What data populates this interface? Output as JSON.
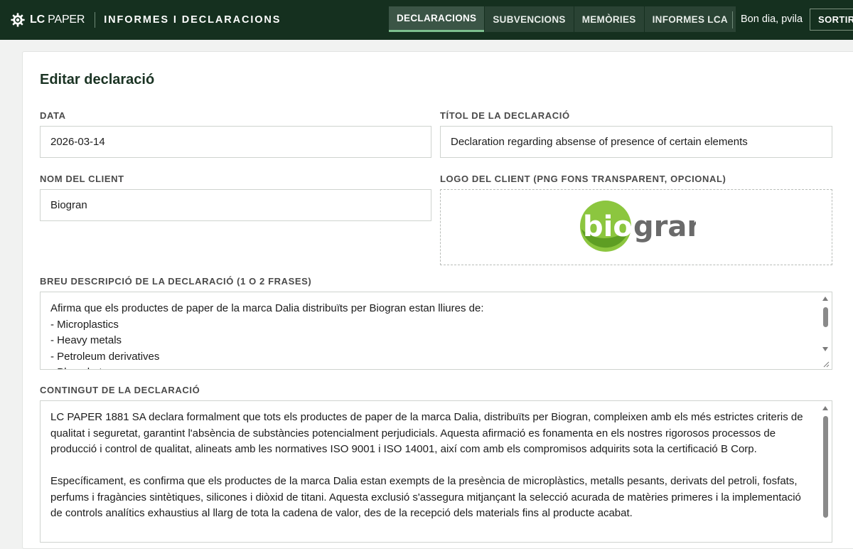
{
  "header": {
    "brand": {
      "bold": "LC",
      "rest": " PAPER"
    },
    "section": "INFORMES I DECLARACIONS",
    "nav": [
      {
        "label": "DECLARACIONS",
        "active": true
      },
      {
        "label": "SUBVENCIONS",
        "active": false
      },
      {
        "label": "MEMÒRIES",
        "active": false
      },
      {
        "label": "INFORMES LCA",
        "active": false
      }
    ],
    "greeting": "Bon dia, pvila",
    "logout_label": "SORTIR"
  },
  "form": {
    "title": "Editar declaració",
    "date": {
      "label": "DATA",
      "value": "2026-03-14"
    },
    "declaration_title": {
      "label": "TÍTOL DE LA DECLARACIÓ",
      "value": "Declaration regarding absense of presence of certain elements"
    },
    "client_name": {
      "label": "NOM DEL CLIENT",
      "value": "Biogran"
    },
    "client_logo": {
      "label": "LOGO DEL CLIENT (PNG FONS TRANSPARENT, OPCIONAL)",
      "logo_text_a": "bio",
      "logo_text_b": "gran"
    },
    "short_description": {
      "label": "BREU DESCRIPCIÓ DE LA DECLARACIÓ (1 O 2 FRASES)",
      "value": "Afirma que els productes de paper de la marca Dalia distribuïts per Biogran estan lliures de:\n- Microplastics\n- Heavy metals\n- Petroleum derivatives\n- Phosphates"
    },
    "content": {
      "label": "CONTINGUT DE LA DECLARACIÓ",
      "value": "LC PAPER 1881 SA declara formalment que tots els productes de paper de la marca Dalia, distribuïts per Biogran, compleixen amb els més estrictes criteris de qualitat i seguretat, garantint l'absència de substàncies potencialment perjudicials. Aquesta afirmació es fonamenta en els nostres rigorosos processos de producció i control de qualitat, alineats amb les normatives ISO 9001 i ISO 14001, així com amb els compromisos adquirits sota la certificació B Corp.\n\nEspecíficament, es confirma que els productes de la marca Dalia estan exempts de la presència de microplàstics, metalls pesants, derivats del petroli, fosfats, perfums i fragàncies sintètiques, silicones i diòxid de titani. Aquesta exclusió s'assegura mitjançant la selecció acurada de matèries primeres i la implementació de controls analítics exhaustius al llarg de tota la cadena de valor, des de la recepció dels materials fins al producte acabat."
    }
  },
  "colors": {
    "topbar": "#15301f",
    "nav_active": "#3b5546",
    "logo_green": "#8cc63f",
    "logo_text": "#6a6a6a"
  }
}
